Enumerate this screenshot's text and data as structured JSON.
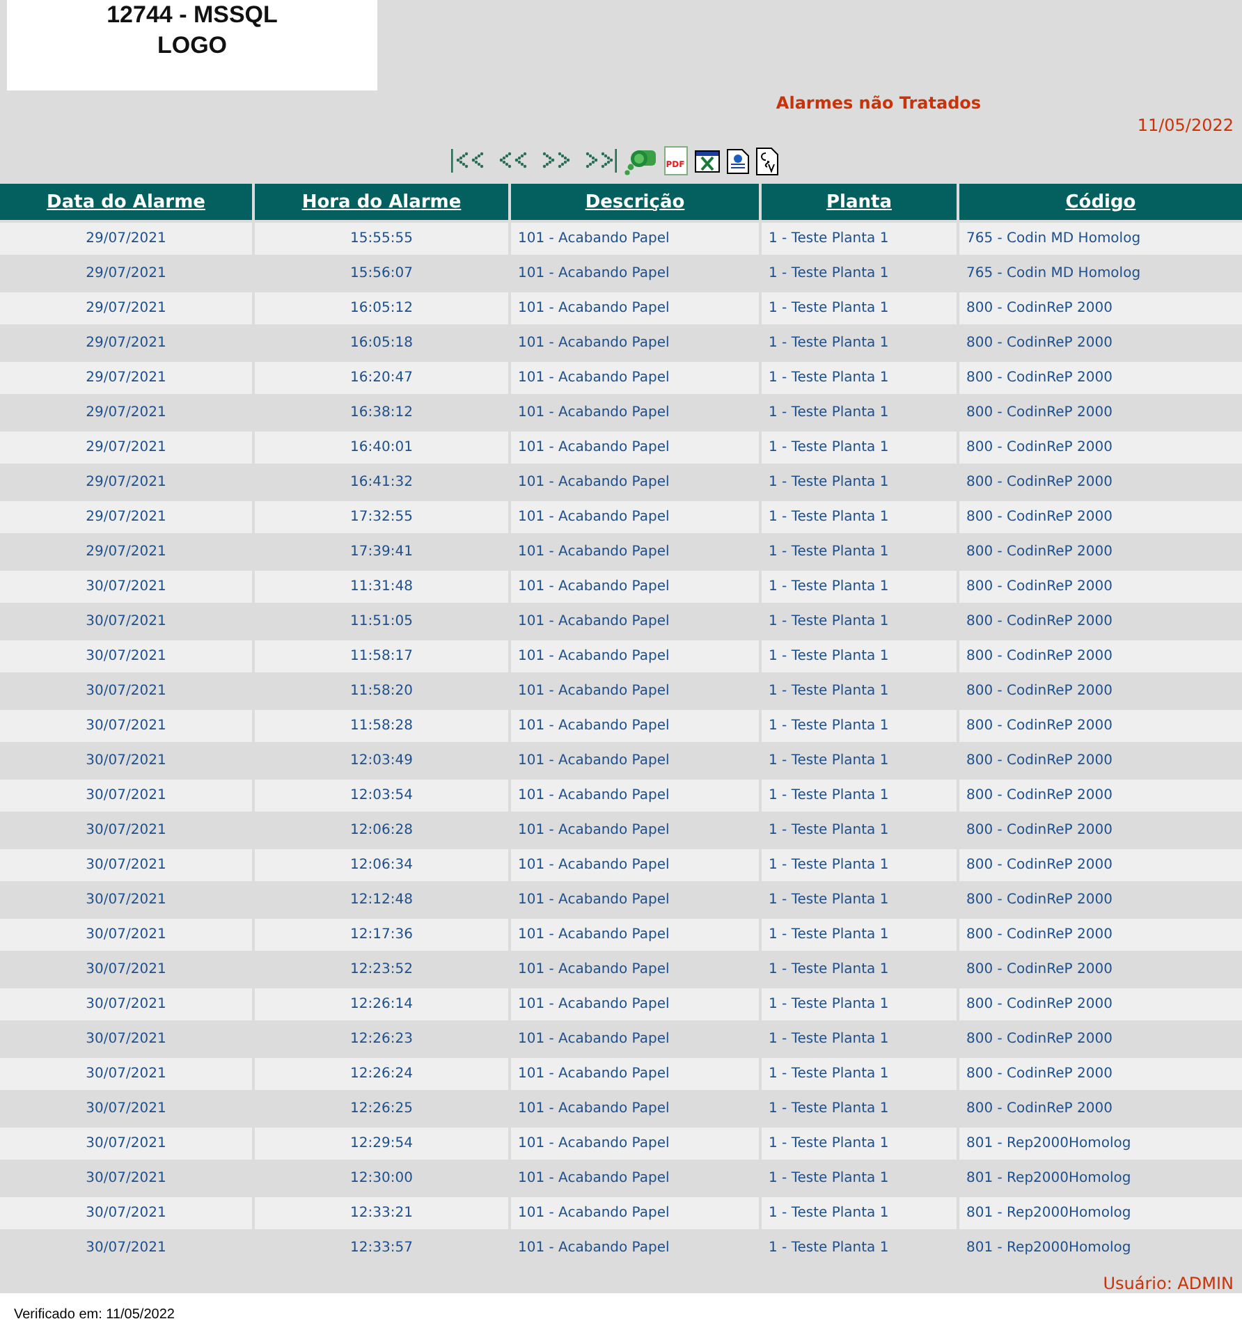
{
  "logo": {
    "lines": [
      "12744 - MSSQL",
      "LOGO"
    ]
  },
  "title": "Alarmes não Tratados",
  "date": "11/05/2022",
  "toolbar": [
    {
      "kind": "first"
    },
    {
      "kind": "prev"
    },
    {
      "kind": "next"
    },
    {
      "kind": "last"
    },
    {
      "kind": "search"
    },
    {
      "kind": "pdf",
      "label": "PDF"
    },
    {
      "kind": "excel"
    },
    {
      "kind": "html"
    },
    {
      "kind": "csv"
    }
  ],
  "table": {
    "columns": [
      "Data do Alarme",
      "Hora do Alarme",
      "Descrição",
      "Planta",
      "Código"
    ],
    "rows": [
      [
        "29/07/2021",
        "15:55:55",
        "101 - Acabando Papel",
        "1 - Teste Planta 1",
        "765 - Codin MD Homolog"
      ],
      [
        "29/07/2021",
        "15:56:07",
        "101 - Acabando Papel",
        "1 - Teste Planta 1",
        "765 - Codin MD Homolog"
      ],
      [
        "29/07/2021",
        "16:05:12",
        "101 - Acabando Papel",
        "1 - Teste Planta 1",
        "800 - CodinReP 2000"
      ],
      [
        "29/07/2021",
        "16:05:18",
        "101 - Acabando Papel",
        "1 - Teste Planta 1",
        "800 - CodinReP 2000"
      ],
      [
        "29/07/2021",
        "16:20:47",
        "101 - Acabando Papel",
        "1 - Teste Planta 1",
        "800 - CodinReP 2000"
      ],
      [
        "29/07/2021",
        "16:38:12",
        "101 - Acabando Papel",
        "1 - Teste Planta 1",
        "800 - CodinReP 2000"
      ],
      [
        "29/07/2021",
        "16:40:01",
        "101 - Acabando Papel",
        "1 - Teste Planta 1",
        "800 - CodinReP 2000"
      ],
      [
        "29/07/2021",
        "16:41:32",
        "101 - Acabando Papel",
        "1 - Teste Planta 1",
        "800 - CodinReP 2000"
      ],
      [
        "29/07/2021",
        "17:32:55",
        "101 - Acabando Papel",
        "1 - Teste Planta 1",
        "800 - CodinReP 2000"
      ],
      [
        "29/07/2021",
        "17:39:41",
        "101 - Acabando Papel",
        "1 - Teste Planta 1",
        "800 - CodinReP 2000"
      ],
      [
        "30/07/2021",
        "11:31:48",
        "101 - Acabando Papel",
        "1 - Teste Planta 1",
        "800 - CodinReP 2000"
      ],
      [
        "30/07/2021",
        "11:51:05",
        "101 - Acabando Papel",
        "1 - Teste Planta 1",
        "800 - CodinReP 2000"
      ],
      [
        "30/07/2021",
        "11:58:17",
        "101 - Acabando Papel",
        "1 - Teste Planta 1",
        "800 - CodinReP 2000"
      ],
      [
        "30/07/2021",
        "11:58:20",
        "101 - Acabando Papel",
        "1 - Teste Planta 1",
        "800 - CodinReP 2000"
      ],
      [
        "30/07/2021",
        "11:58:28",
        "101 - Acabando Papel",
        "1 - Teste Planta 1",
        "800 - CodinReP 2000"
      ],
      [
        "30/07/2021",
        "12:03:49",
        "101 - Acabando Papel",
        "1 - Teste Planta 1",
        "800 - CodinReP 2000"
      ],
      [
        "30/07/2021",
        "12:03:54",
        "101 - Acabando Papel",
        "1 - Teste Planta 1",
        "800 - CodinReP 2000"
      ],
      [
        "30/07/2021",
        "12:06:28",
        "101 - Acabando Papel",
        "1 - Teste Planta 1",
        "800 - CodinReP 2000"
      ],
      [
        "30/07/2021",
        "12:06:34",
        "101 - Acabando Papel",
        "1 - Teste Planta 1",
        "800 - CodinReP 2000"
      ],
      [
        "30/07/2021",
        "12:12:48",
        "101 - Acabando Papel",
        "1 - Teste Planta 1",
        "800 - CodinReP 2000"
      ],
      [
        "30/07/2021",
        "12:17:36",
        "101 - Acabando Papel",
        "1 - Teste Planta 1",
        "800 - CodinReP 2000"
      ],
      [
        "30/07/2021",
        "12:23:52",
        "101 - Acabando Papel",
        "1 - Teste Planta 1",
        "800 - CodinReP 2000"
      ],
      [
        "30/07/2021",
        "12:26:14",
        "101 - Acabando Papel",
        "1 - Teste Planta 1",
        "800 - CodinReP 2000"
      ],
      [
        "30/07/2021",
        "12:26:23",
        "101 - Acabando Papel",
        "1 - Teste Planta 1",
        "800 - CodinReP 2000"
      ],
      [
        "30/07/2021",
        "12:26:24",
        "101 - Acabando Papel",
        "1 - Teste Planta 1",
        "800 - CodinReP 2000"
      ],
      [
        "30/07/2021",
        "12:26:25",
        "101 - Acabando Papel",
        "1 - Teste Planta 1",
        "800 - CodinReP 2000"
      ],
      [
        "30/07/2021",
        "12:29:54",
        "101 - Acabando Papel",
        "1 - Teste Planta 1",
        "801 - Rep2000Homolog"
      ],
      [
        "30/07/2021",
        "12:30:00",
        "101 - Acabando Papel",
        "1 - Teste Planta 1",
        "801 - Rep2000Homolog"
      ],
      [
        "30/07/2021",
        "12:33:21",
        "101 - Acabando Papel",
        "1 - Teste Planta 1",
        "801 - Rep2000Homolog"
      ],
      [
        "30/07/2021",
        "12:33:57",
        "101 - Acabando Papel",
        "1 - Teste Planta 1",
        "801 - Rep2000Homolog"
      ]
    ]
  },
  "user": "Usuário: ADMIN",
  "verified": "Verificado em: 11/05/2022"
}
